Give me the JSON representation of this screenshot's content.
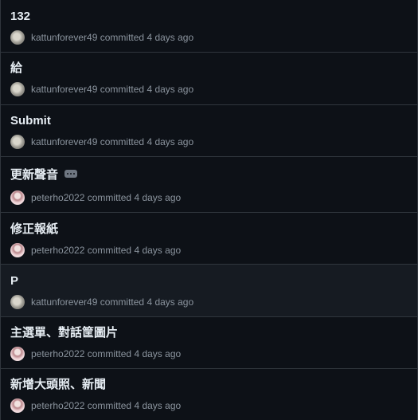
{
  "commits": [
    {
      "title": "132",
      "author": "kattunforever49",
      "action": "committed",
      "time": "4 days ago",
      "avatar": "kattunforever49-avatar"
    },
    {
      "title": "給",
      "author": "kattunforever49",
      "action": "committed",
      "time": "4 days ago",
      "avatar": "kattunforever49-avatar"
    },
    {
      "title": "Submit",
      "author": "kattunforever49",
      "action": "committed",
      "time": "4 days ago",
      "avatar": "kattunforever49-avatar"
    },
    {
      "title": "更新聲音",
      "author": "peterho2022",
      "action": "committed",
      "time": "4 days ago",
      "avatar": "peterho2022-avatar",
      "has_ellipsis": true
    },
    {
      "title": "修正報紙",
      "author": "peterho2022",
      "action": "committed",
      "time": "4 days ago",
      "avatar": "peterho2022-avatar"
    },
    {
      "title": "P",
      "author": "kattunforever49",
      "action": "committed",
      "time": "4 days ago",
      "avatar": "kattunforever49-avatar"
    },
    {
      "title": "主選單、對話筐圖片",
      "author": "peterho2022",
      "action": "committed",
      "time": "4 days ago",
      "avatar": "peterho2022-avatar"
    },
    {
      "title": "新增大頭照、新聞",
      "author": "peterho2022",
      "action": "committed",
      "time": "4 days ago",
      "avatar": "peterho2022-avatar"
    }
  ]
}
